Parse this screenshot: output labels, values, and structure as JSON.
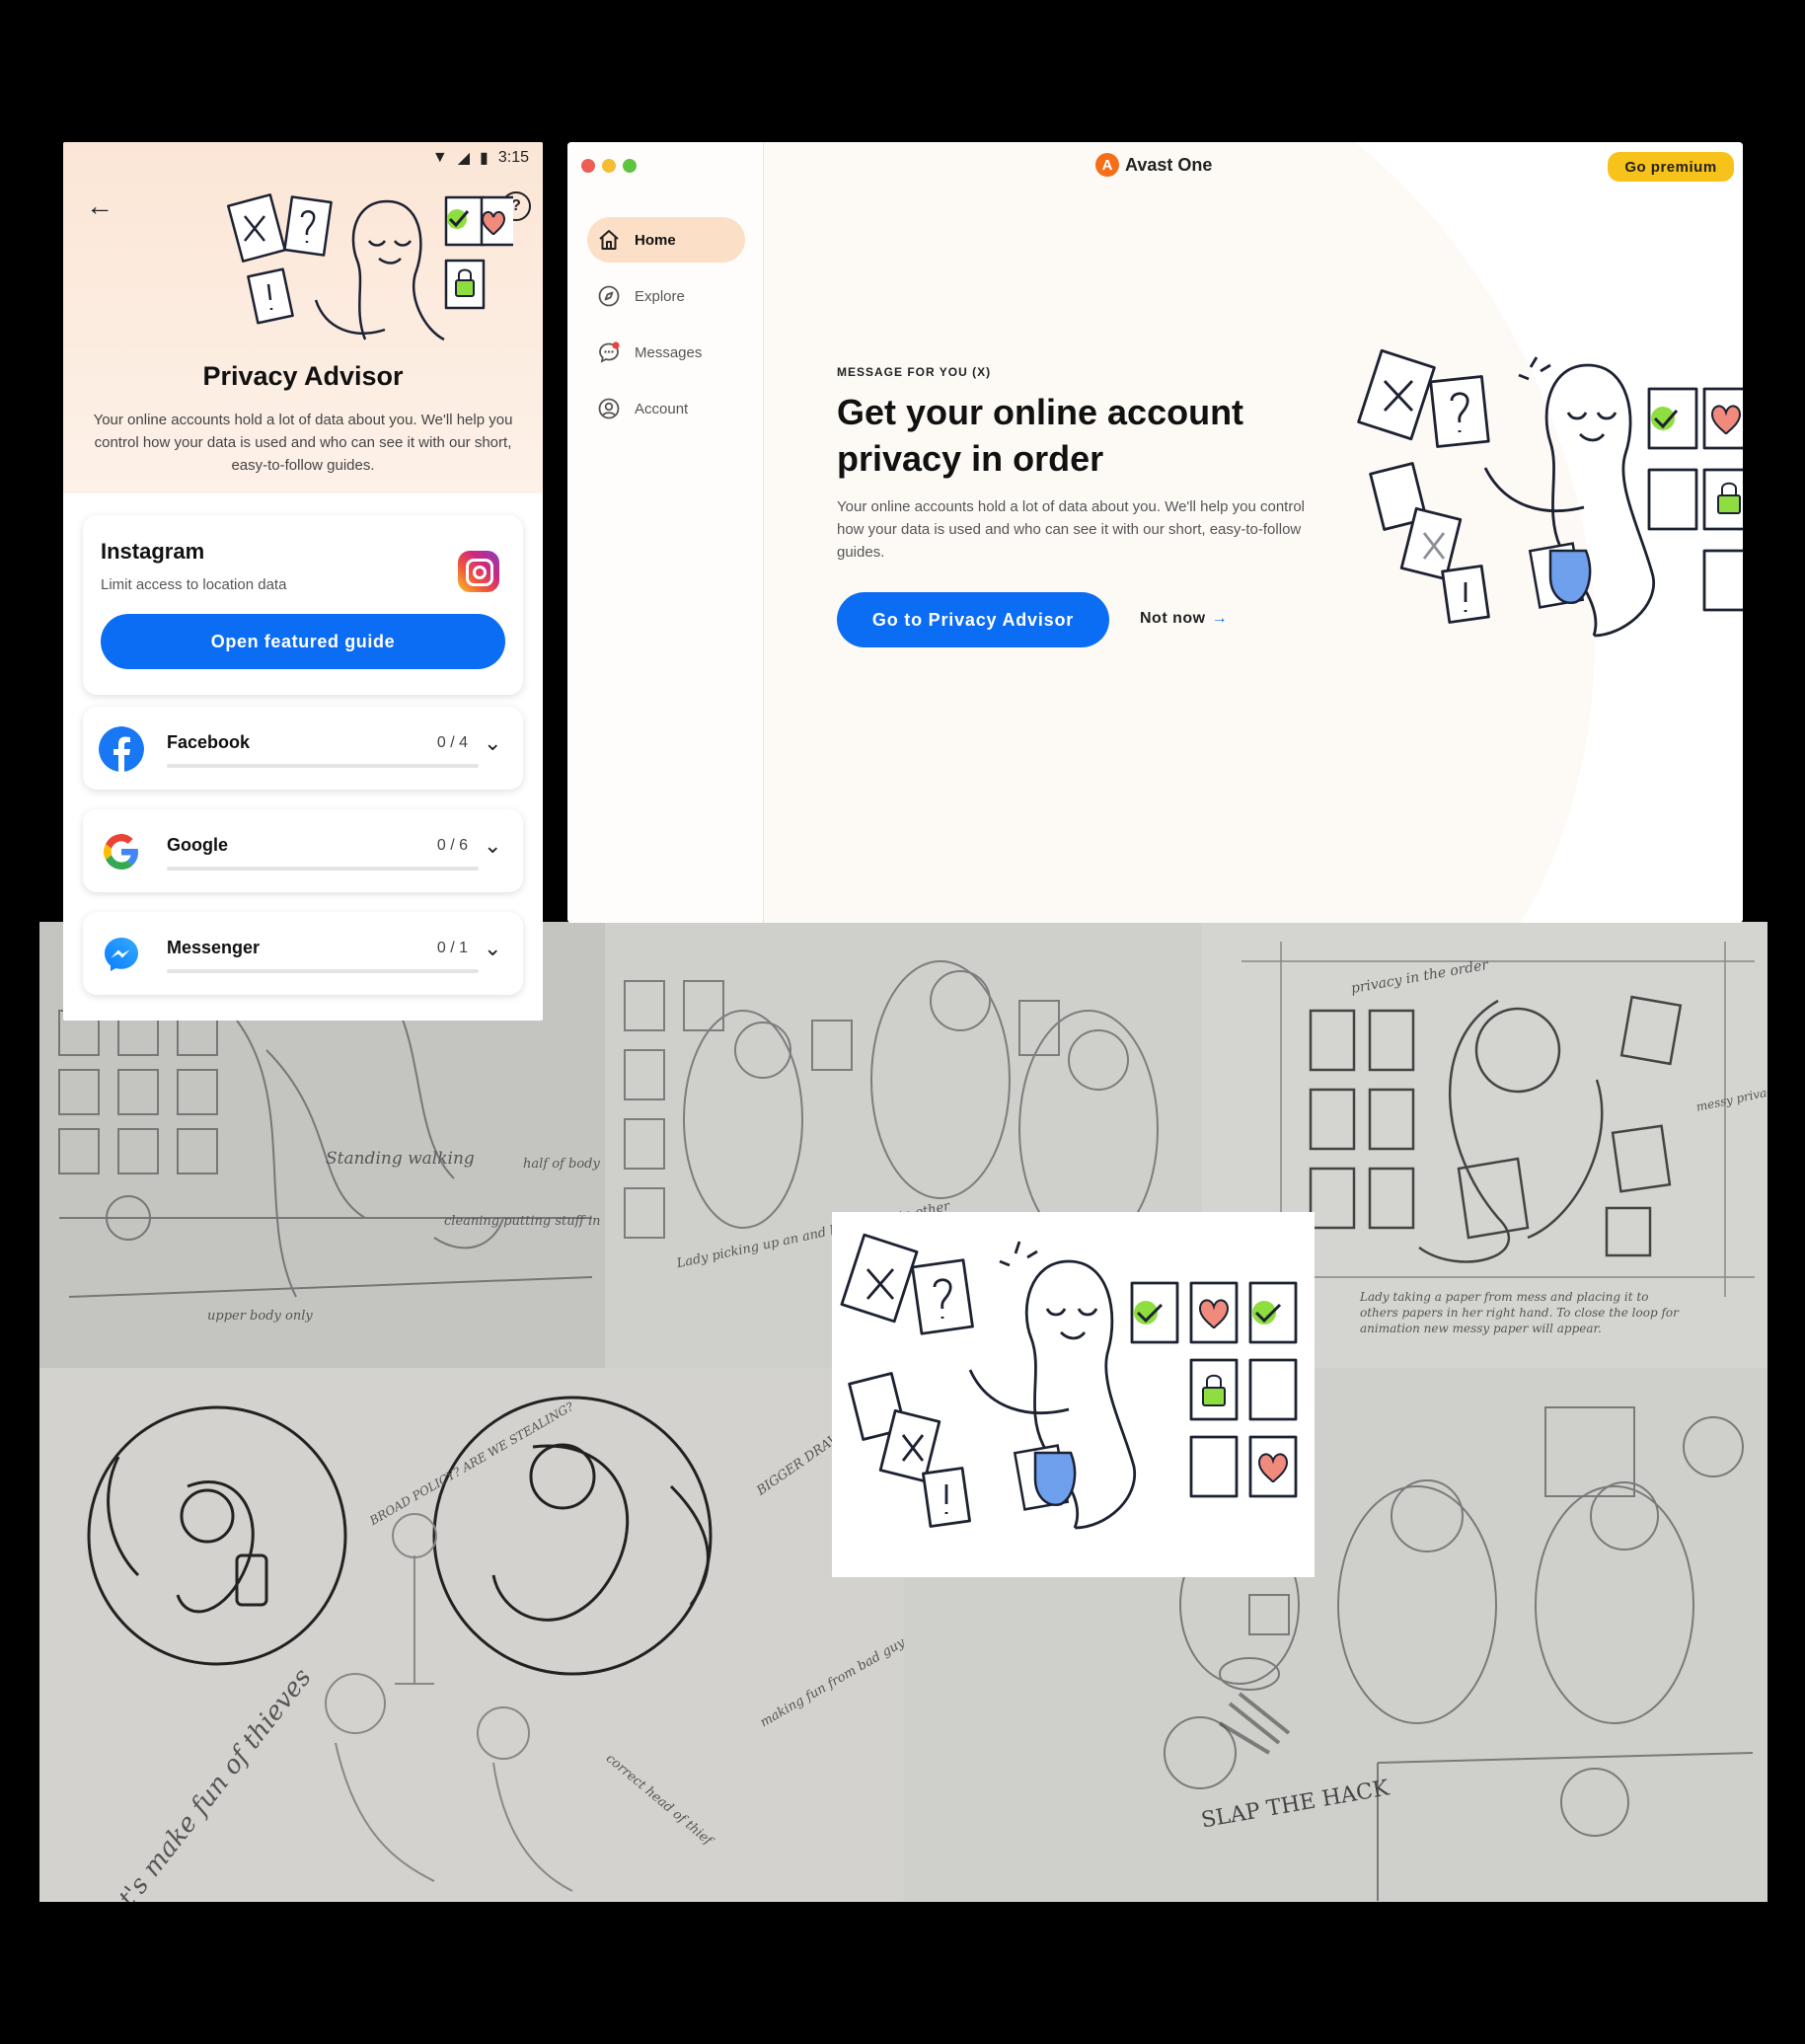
{
  "phone": {
    "status_time": "3:15",
    "title": "Privacy Advisor",
    "description": "Your online accounts hold a lot of data about you. We'll help you control how your data is used and who can see it with our short, easy-to-follow guides.",
    "featured": {
      "title": "Instagram",
      "subtitle": "Limit access to location data",
      "button": "Open featured guide",
      "icon": "instagram-icon"
    },
    "accounts": [
      {
        "name": "Facebook",
        "count": "0 / 4",
        "icon": "facebook-icon",
        "progress": 0
      },
      {
        "name": "Google",
        "count": "0 / 6",
        "icon": "google-icon",
        "progress": 0
      },
      {
        "name": "Messenger",
        "count": "0 / 1",
        "icon": "messenger-icon",
        "progress": 0
      }
    ]
  },
  "desktop": {
    "brand": "Avast One",
    "premium_button": "Go premium",
    "nav": [
      {
        "label": "Home",
        "icon": "home-icon",
        "active": true
      },
      {
        "label": "Explore",
        "icon": "compass-icon",
        "active": false
      },
      {
        "label": "Messages",
        "icon": "chat-icon",
        "active": false
      },
      {
        "label": "Account",
        "icon": "user-icon",
        "active": false
      }
    ],
    "kicker": "MESSAGE FOR YOU (X)",
    "headline": "Get your online account privacy in order",
    "description": "Your online accounts hold a lot of data about you. We'll help you control how your data is used and who can see it with our short, easy-to-follow guides.",
    "primary_button": "Go to Privacy Advisor",
    "secondary_button": "Not now"
  },
  "sketches": {
    "notes": [
      "Standing walking",
      "half of body will be better",
      "cleaning putting stuff in to profile",
      "upper body only",
      "Lady picking up an and handing it to other",
      "privacy in the order",
      "messy privacy",
      "Lady taking a paper from mess and placing it to others papers in her right hand. To close the loop for animation new messy paper will appear.",
      "BIGGER DRAWING OF SWEAT",
      "BROAD POLICY? ARE WE STEALING?",
      "making fun from bad guys",
      "let's make fun of thieves",
      "correct head of thief",
      "SLAP THE HACK"
    ]
  },
  "colors": {
    "primary_blue": "#0b6df4",
    "premium_yellow": "#f7c21a",
    "peach": "#fcdfc7",
    "check_green": "#8ede3f",
    "heart_red": "#f08a7c"
  }
}
